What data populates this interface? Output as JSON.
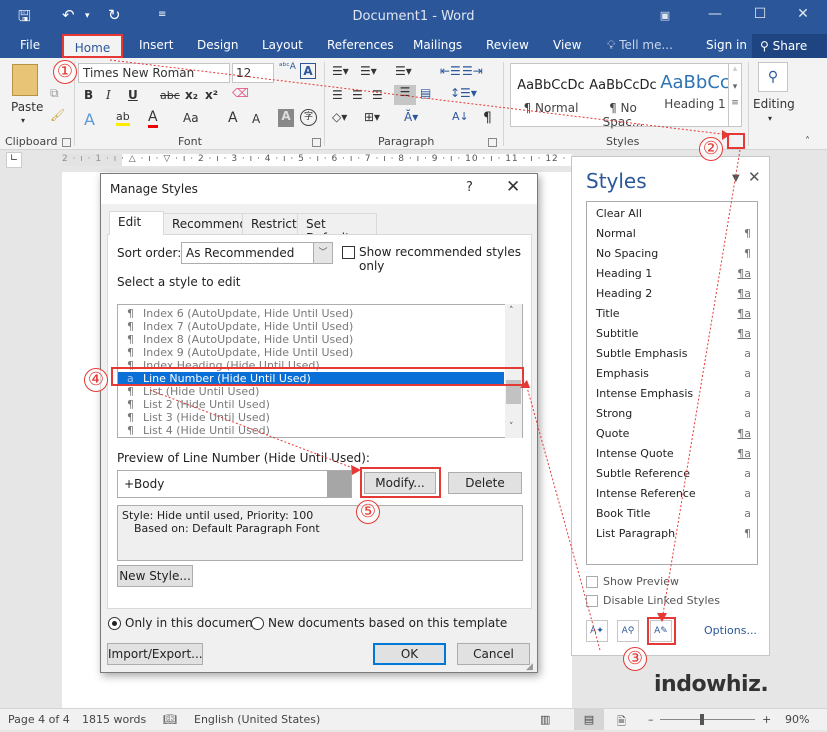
{
  "window": {
    "title": "Document1 - Word",
    "quick_access": {
      "save_icon": "save-icon",
      "undo_icon": "undo-icon",
      "redo_icon": "redo-icon",
      "customize_icon": "customize-icon"
    },
    "controls": {
      "ribbon_display": "▣",
      "minimize": "—",
      "maximize": "☐",
      "close": "✕"
    }
  },
  "tabs": [
    "File",
    "Home",
    "Insert",
    "Design",
    "Layout",
    "References",
    "Mailings",
    "Review",
    "View"
  ],
  "active_tab": "Home",
  "tell_me": "Tell me...",
  "sign_in": "Sign in",
  "share": "Share",
  "ribbon": {
    "clipboard": {
      "label": "Clipboard",
      "paste": "Paste"
    },
    "font": {
      "label": "Font",
      "font_name": "Times New Roman",
      "font_size": "12",
      "bold": "B",
      "italic": "I",
      "underline": "U",
      "strikethrough": "abc",
      "subscript": "x₂",
      "superscript": "x²",
      "change_case": "Aa",
      "grow": "A",
      "shrink": "A"
    },
    "paragraph": {
      "label": "Paragraph",
      "pilcrow": "¶"
    },
    "styles": {
      "label": "Styles",
      "gallery": [
        {
          "preview": "AaBbCcDc",
          "name": "¶ Normal"
        },
        {
          "preview": "AaBbCcDc",
          "name": "¶ No Spac..."
        },
        {
          "preview": "AaBbCc",
          "name": "Heading 1"
        }
      ]
    },
    "editing": {
      "label": "Editing"
    }
  },
  "ruler": {
    "ticks": "2 · ı · 1 · ı · △ · ı · ▽ · ı · 2 · ı · 3 · ı · 4 · ı · 5 · ı · 6 · ı · 7 · ı · 8 · ı · 9 · ı · 10 · ı · 11 · ı · 12 · ı · 13"
  },
  "dialog": {
    "title": "Manage Styles",
    "help": "?",
    "close": "✕",
    "tabs": [
      "Edit",
      "Recommend",
      "Restrict",
      "Set Defaults"
    ],
    "active_tab": "Edit",
    "sort_order_label": "Sort order:",
    "sort_order_value": "As Recommended",
    "show_recommended_label": "Show recommended styles only",
    "show_recommended_checked": false,
    "select_label": "Select a style to edit",
    "styles_list": [
      {
        "glyph": "¶",
        "text": "Index 6  (AutoUpdate, Hide Until Used)"
      },
      {
        "glyph": "¶",
        "text": "Index 7  (AutoUpdate, Hide Until Used)"
      },
      {
        "glyph": "¶",
        "text": "Index 8  (AutoUpdate, Hide Until Used)"
      },
      {
        "glyph": "¶",
        "text": "Index 9  (AutoUpdate, Hide Until Used)"
      },
      {
        "glyph": "¶",
        "text": "Index Heading  (Hide Until Used)"
      },
      {
        "glyph": "a",
        "text": "Line Number  (Hide Until Used)",
        "selected": true
      },
      {
        "glyph": "¶",
        "text": "List  (Hide Until Used)"
      },
      {
        "glyph": "¶",
        "text": "List 2  (Hide Until Used)"
      },
      {
        "glyph": "¶",
        "text": "List 3  (Hide Until Used)"
      },
      {
        "glyph": "¶",
        "text": "List 4  (Hide Until Used)"
      }
    ],
    "preview_label": "Preview of Line Number  (Hide Until Used):",
    "preview_text": "+Body",
    "modify": "Modify...",
    "delete": "Delete",
    "description_line1": "Style: Hide until used, Priority: 100",
    "description_line2": "Based on: Default Paragraph Font",
    "new_style": "New Style...",
    "radio_only_doc": "Only in this document",
    "radio_new_docs": "New documents based on this template",
    "radio_selected": "only_doc",
    "import_export": "Import/Export...",
    "ok": "OK",
    "cancel": "Cancel"
  },
  "styles_pane": {
    "title": "Styles",
    "items": [
      {
        "name": "Clear All",
        "glyph": ""
      },
      {
        "name": "Normal",
        "glyph": "¶"
      },
      {
        "name": "No Spacing",
        "glyph": "¶"
      },
      {
        "name": "Heading 1",
        "glyph": "¶a",
        "u": true
      },
      {
        "name": "Heading 2",
        "glyph": "¶a",
        "u": true
      },
      {
        "name": "Title",
        "glyph": "¶a",
        "u": true
      },
      {
        "name": "Subtitle",
        "glyph": "¶a",
        "u": true
      },
      {
        "name": "Subtle Emphasis",
        "glyph": "a"
      },
      {
        "name": "Emphasis",
        "glyph": "a"
      },
      {
        "name": "Intense Emphasis",
        "glyph": "a"
      },
      {
        "name": "Strong",
        "glyph": "a"
      },
      {
        "name": "Quote",
        "glyph": "¶a",
        "u": true
      },
      {
        "name": "Intense Quote",
        "glyph": "¶a",
        "u": true
      },
      {
        "name": "Subtle Reference",
        "glyph": "a"
      },
      {
        "name": "Intense Reference",
        "glyph": "a"
      },
      {
        "name": "Book Title",
        "glyph": "a"
      },
      {
        "name": "List Paragraph",
        "glyph": "¶"
      }
    ],
    "show_preview": "Show Preview",
    "disable_linked": "Disable Linked Styles",
    "options": "Options..."
  },
  "annotations": [
    "①",
    "②",
    "③",
    "④",
    "⑤"
  ],
  "watermark": "indowhiz.",
  "status": {
    "page": "Page 4 of 4",
    "words": "1815 words",
    "language": "English (United States)",
    "zoom": "90%",
    "zoom_percent": 90
  },
  "colors": {
    "accent": "#2b579a",
    "annotation": "#e53935",
    "selection": "#0a6fd6"
  }
}
